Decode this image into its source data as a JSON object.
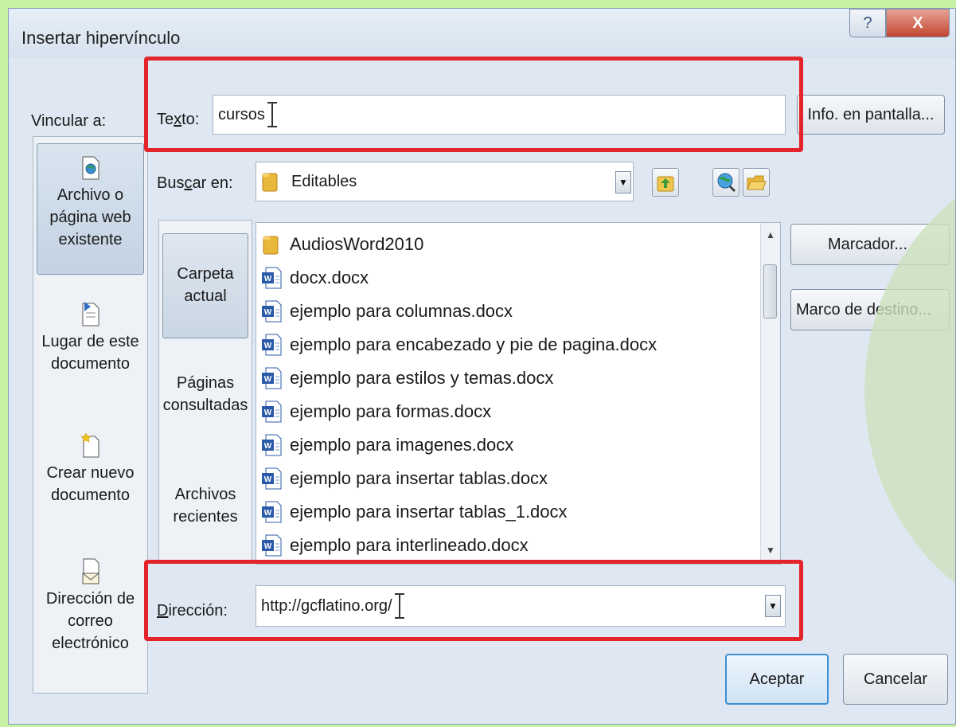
{
  "dialog": {
    "title": "Insertar hipervínculo",
    "help_label": "?",
    "close_label": "X"
  },
  "link_to_label": "Vincular a:",
  "text_field": {
    "label": "Texto:",
    "value": "cursos"
  },
  "screen_tip_label": "Info. en pantalla...",
  "look_in": {
    "label": "Buscar en:",
    "value": "Editables"
  },
  "link_to_options": [
    {
      "line1": "Archivo o",
      "line2": "página web",
      "line3": "existente"
    },
    {
      "line1": "Lugar de este",
      "line2": "documento"
    },
    {
      "line1": "Crear nuevo",
      "line2": "documento"
    },
    {
      "line1": "Dirección de",
      "line2": "correo",
      "line3": "electrónico"
    }
  ],
  "browse_options": [
    {
      "line1": "Carpeta",
      "line2": "actual"
    },
    {
      "line1": "Páginas",
      "line2": "consultadas"
    },
    {
      "line1": "Archivos",
      "line2": "recientes"
    }
  ],
  "files": [
    {
      "name": "AudiosWord2010",
      "type": "folder"
    },
    {
      "name": "docx.docx",
      "type": "word"
    },
    {
      "name": "ejemplo para columnas.docx",
      "type": "word"
    },
    {
      "name": "ejemplo para encabezado y pie de pagina.docx",
      "type": "word"
    },
    {
      "name": "ejemplo para estilos y temas.docx",
      "type": "word"
    },
    {
      "name": "ejemplo para formas.docx",
      "type": "word"
    },
    {
      "name": "ejemplo para imagenes.docx",
      "type": "word"
    },
    {
      "name": "ejemplo para insertar tablas.docx",
      "type": "word"
    },
    {
      "name": "ejemplo para insertar tablas_1.docx",
      "type": "word"
    },
    {
      "name": "ejemplo para interlineado.docx",
      "type": "word"
    }
  ],
  "bookmark_label": "Marcador...",
  "target_frame_label": "Marco de destino...",
  "address": {
    "label": "Dirección:",
    "value": "http://gcflatino.org/"
  },
  "ok_label": "Aceptar",
  "cancel_label": "Cancelar",
  "colors": {
    "highlight": "#e3242b",
    "page_background": "#c6f0a4",
    "dialog_background": "#dfe8f2"
  }
}
